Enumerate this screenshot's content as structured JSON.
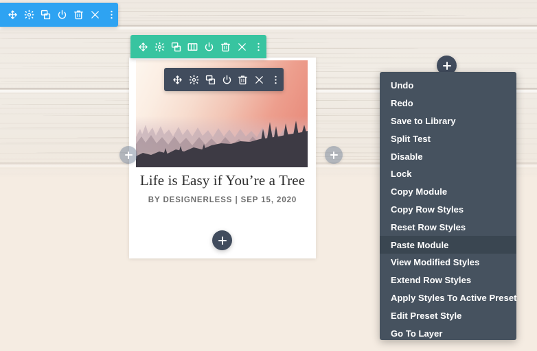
{
  "section_toolbar": {
    "name": "section-settings-toolbar",
    "color": "#2EA3F2",
    "buttons": [
      {
        "icon": "move-icon",
        "label": "Move Section"
      },
      {
        "icon": "gear-icon",
        "label": "Section Settings"
      },
      {
        "icon": "duplicate-icon",
        "label": "Duplicate Section"
      },
      {
        "icon": "power-icon",
        "label": "Disable Section"
      },
      {
        "icon": "trash-icon",
        "label": "Delete Section"
      },
      {
        "icon": "close-icon",
        "label": "Close Section"
      },
      {
        "icon": "kebab-menu-icon",
        "label": "More Options"
      }
    ]
  },
  "row_toolbar": {
    "name": "row-settings-toolbar",
    "color": "#38C4A0",
    "buttons": [
      {
        "icon": "move-icon",
        "label": "Move Row"
      },
      {
        "icon": "gear-icon",
        "label": "Row Settings"
      },
      {
        "icon": "duplicate-icon",
        "label": "Duplicate Row"
      },
      {
        "icon": "columns-icon",
        "label": "Change Column Structure"
      },
      {
        "icon": "power-icon",
        "label": "Disable Row"
      },
      {
        "icon": "trash-icon",
        "label": "Delete Row"
      },
      {
        "icon": "close-icon",
        "label": "Close Row"
      },
      {
        "icon": "kebab-menu-icon",
        "label": "More Options"
      }
    ]
  },
  "module_toolbar": {
    "name": "module-settings-toolbar",
    "color": "#414C5D",
    "buttons": [
      {
        "icon": "move-icon",
        "label": "Move Module"
      },
      {
        "icon": "gear-icon",
        "label": "Module Settings"
      },
      {
        "icon": "duplicate-icon",
        "label": "Duplicate Module"
      },
      {
        "icon": "power-icon",
        "label": "Disable Module"
      },
      {
        "icon": "trash-icon",
        "label": "Delete Module"
      },
      {
        "icon": "close-icon",
        "label": "Close Module"
      },
      {
        "icon": "kebab-menu-icon",
        "label": "More Options"
      }
    ]
  },
  "blog_card": {
    "title": "Life is Easy if You’re a Tree",
    "meta": "BY DESIGNERLESS | SEP 15, 2020",
    "image_alt": "Misty forest landscape at sunrise"
  },
  "add_buttons": [
    {
      "name": "add-column-left",
      "icon": "plus-icon",
      "label": "Add Column Left",
      "style": "ghost"
    },
    {
      "name": "add-column-right",
      "icon": "plus-icon",
      "label": "Add Column Right",
      "style": "ghost"
    },
    {
      "name": "add-module-button",
      "icon": "plus-icon",
      "label": "Add New Module",
      "style": "dark"
    },
    {
      "name": "add-row-button",
      "icon": "plus-icon",
      "label": "Add New Row",
      "style": "dark"
    }
  ],
  "context_menu": {
    "name": "right-click-context-menu",
    "background": "#46525F",
    "highlight": "#3A4651",
    "items": [
      {
        "label": "Undo",
        "active": false
      },
      {
        "label": "Redo",
        "active": false
      },
      {
        "label": "Save to Library",
        "active": false
      },
      {
        "label": "Split Test",
        "active": false
      },
      {
        "label": "Disable",
        "active": false
      },
      {
        "label": "Lock",
        "active": false
      },
      {
        "label": "Copy Module",
        "active": false
      },
      {
        "label": "Copy Row Styles",
        "active": false
      },
      {
        "label": "Reset Row Styles",
        "active": false
      },
      {
        "label": "Paste Module",
        "active": true
      },
      {
        "label": "View Modified Styles",
        "active": false
      },
      {
        "label": "Extend Row Styles",
        "active": false
      },
      {
        "label": "Apply Styles To Active Preset",
        "active": false
      },
      {
        "label": "Edit Preset Style",
        "active": false
      },
      {
        "label": "Go To Layer",
        "active": false
      }
    ]
  },
  "canvas": {
    "background_description": "whitewashed wood plank backdrop",
    "wood_color": "#EFE9E2",
    "page_color": "#F5ECE2"
  }
}
